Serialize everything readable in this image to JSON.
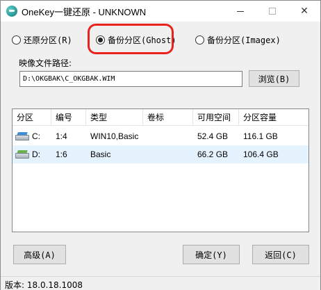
{
  "window": {
    "title": "OneKey一键还原 - UNKNOWN",
    "minimize": "─",
    "maximize": "□",
    "close": "✕"
  },
  "mode": {
    "restore_label": "还原分区(R)",
    "ghost_label": "备份分区(Ghost)",
    "imagex_label": "备份分区(Imagex)",
    "selected": "ghost",
    "highlight_color": "#e8231e"
  },
  "image_path": {
    "label": "映像文件路径:",
    "value": "D:\\OKGBAK\\C_OKGBAK.WIM",
    "browse_label": "浏览(B)"
  },
  "partitions": {
    "columns": [
      "分区",
      "编号",
      "类型",
      "卷标",
      "可用空间",
      "分区容量"
    ],
    "rows": [
      {
        "drive": "C:",
        "number": "1:4",
        "type": "WIN10,Basic",
        "label": "",
        "free": "52.4 GB",
        "capacity": "116.1 GB",
        "icon": "system-drive-icon"
      },
      {
        "drive": "D:",
        "number": "1:6",
        "type": "Basic",
        "label": "",
        "free": "66.2 GB",
        "capacity": "106.4 GB",
        "icon": "drive-icon"
      }
    ],
    "selected_row_color": "#e5f3ff"
  },
  "buttons": {
    "advanced": "高级(A)",
    "ok": "确定(Y)",
    "back": "返回(C)"
  },
  "status": {
    "version": "版本: 18.0.18.1008"
  }
}
